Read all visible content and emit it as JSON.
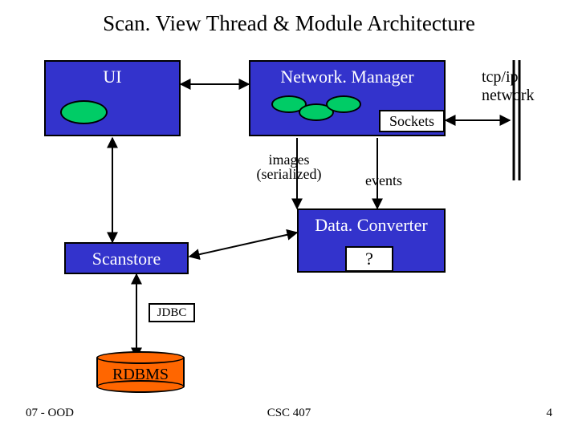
{
  "title": "Scan. View Thread & Module Architecture",
  "modules": {
    "ui": "UI",
    "network_manager": "Network. Manager",
    "sockets": "Sockets",
    "data_converter": "Data. Converter",
    "scanstore": "Scanstore",
    "jdbc": "JDBC",
    "rdbms": "RDBMS"
  },
  "labels": {
    "tcpip_line1": "tcp/ip",
    "tcpip_line2": "network",
    "images_line1": "images",
    "images_line2": "(serialized)",
    "events": "events",
    "question": "?"
  },
  "footer": {
    "left": "07 - OOD",
    "center": "CSC 407",
    "right": "4"
  },
  "colors": {
    "module_fill": "#3333cc",
    "thread_fill": "#00cc66",
    "rdbms_fill": "#ff6600"
  },
  "chart_data": {
    "type": "diagram",
    "title": "Scan. View Thread & Module Architecture",
    "nodes": [
      {
        "id": "UI",
        "kind": "module",
        "threads": 1
      },
      {
        "id": "Network.Manager",
        "kind": "module",
        "threads": 3,
        "contains": [
          "Sockets"
        ]
      },
      {
        "id": "Sockets",
        "kind": "submodule"
      },
      {
        "id": "Data.Converter",
        "kind": "module",
        "contains": [
          "?"
        ]
      },
      {
        "id": "?",
        "kind": "submodule"
      },
      {
        "id": "Scanstore",
        "kind": "module"
      },
      {
        "id": "JDBC",
        "kind": "submodule"
      },
      {
        "id": "RDBMS",
        "kind": "datastore"
      },
      {
        "id": "tcp/ip network",
        "kind": "external"
      }
    ],
    "edges": [
      {
        "from": "UI",
        "to": "Network.Manager",
        "dir": "both"
      },
      {
        "from": "UI",
        "to": "Scanstore",
        "dir": "both"
      },
      {
        "from": "Network.Manager",
        "to": "tcp/ip network",
        "via": "Sockets",
        "dir": "both"
      },
      {
        "from": "Network.Manager",
        "to": "Data.Converter",
        "label": "images (serialized)",
        "dir": "to"
      },
      {
        "from": "Network.Manager",
        "to": "Data.Converter",
        "label": "events",
        "dir": "to"
      },
      {
        "from": "Scanstore",
        "to": "Data.Converter",
        "dir": "both"
      },
      {
        "from": "Scanstore",
        "to": "RDBMS",
        "via": "JDBC",
        "dir": "both"
      }
    ]
  }
}
